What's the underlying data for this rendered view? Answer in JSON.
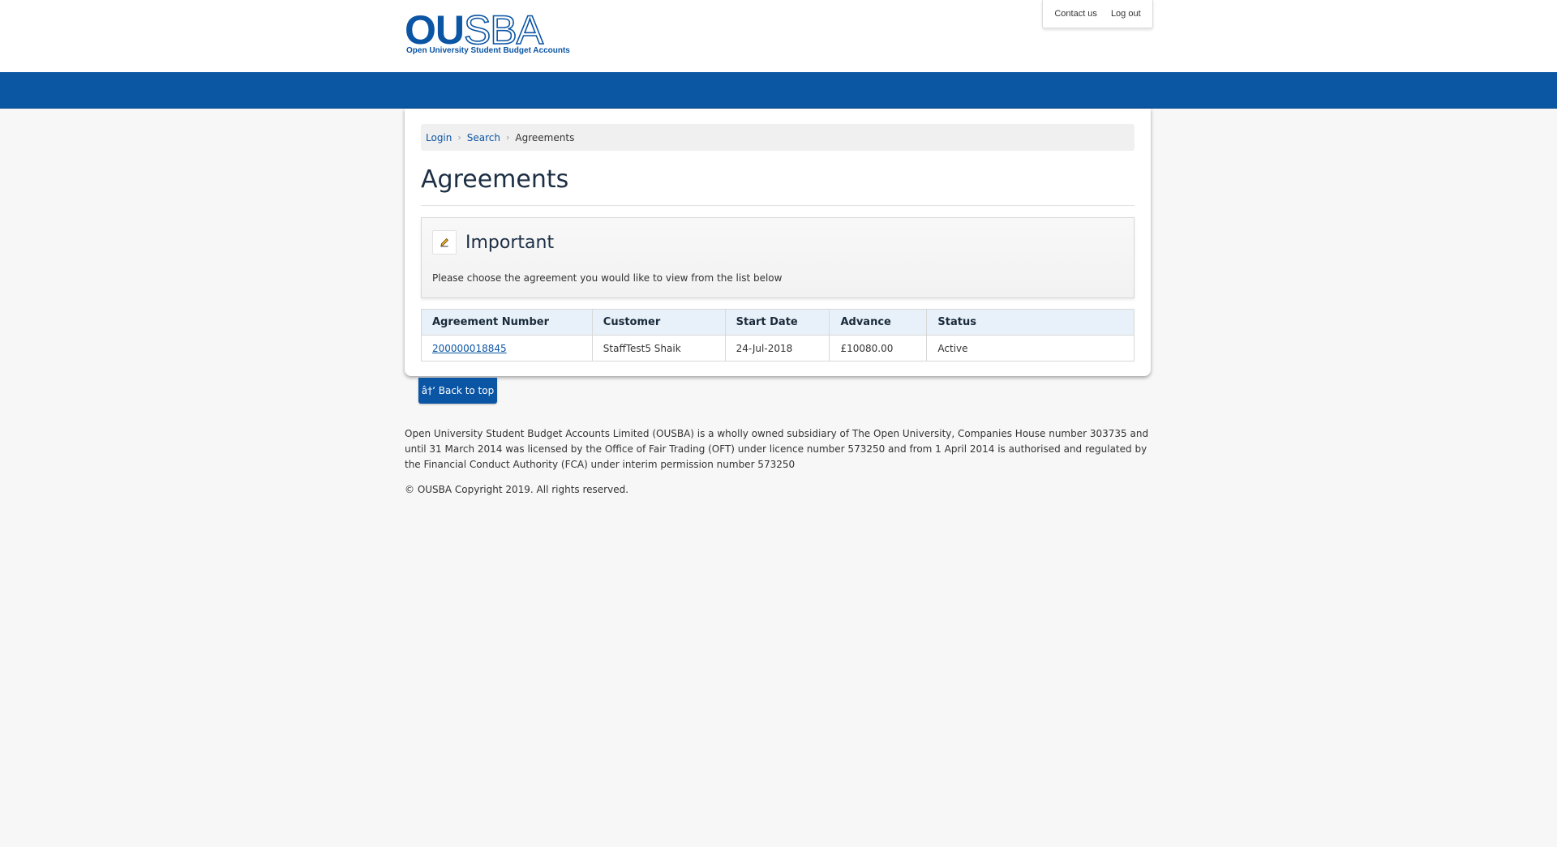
{
  "header": {
    "logo_word": "OUSBA",
    "logo_tagline": "Open University Student Budget Accounts",
    "utility_links": [
      "Contact us",
      "Log out"
    ]
  },
  "breadcrumb": [
    "Login",
    "Search",
    "Agreements"
  ],
  "page_title": "Agreements",
  "notice": {
    "icon": "pencil-icon",
    "title": "Important",
    "text": "Please choose the agreement you would like to view from the list below"
  },
  "table": {
    "headers": [
      "Agreement Number",
      "Customer",
      "Start Date",
      "Advance",
      "Status"
    ],
    "rows": [
      [
        "200000018845",
        "StaffTest5 Shaik",
        "24-Jul-2018",
        "£10080.00",
        "Active"
      ]
    ]
  },
  "back_to_top": "â†‘ Back to top",
  "footer": {
    "disclaimer": "Open University Student Budget Accounts Limited (OUSBA) is a wholly owned subsidiary of The Open University, Companies House number 303735 and until 31 March 2014 was licensed by the Office of Fair Trading (OFT) under licence number 573250 and from 1 April 2014 is authorised and regulated by the Financial Conduct Authority (FCA) under interim permission number 573250",
    "copyright": "© OUSBA Copyright 2019. All rights reserved."
  },
  "colors": {
    "brand_blue": "#0b57a4",
    "page_background": "#f7f7f7",
    "table_header": "#e8f1fa"
  }
}
